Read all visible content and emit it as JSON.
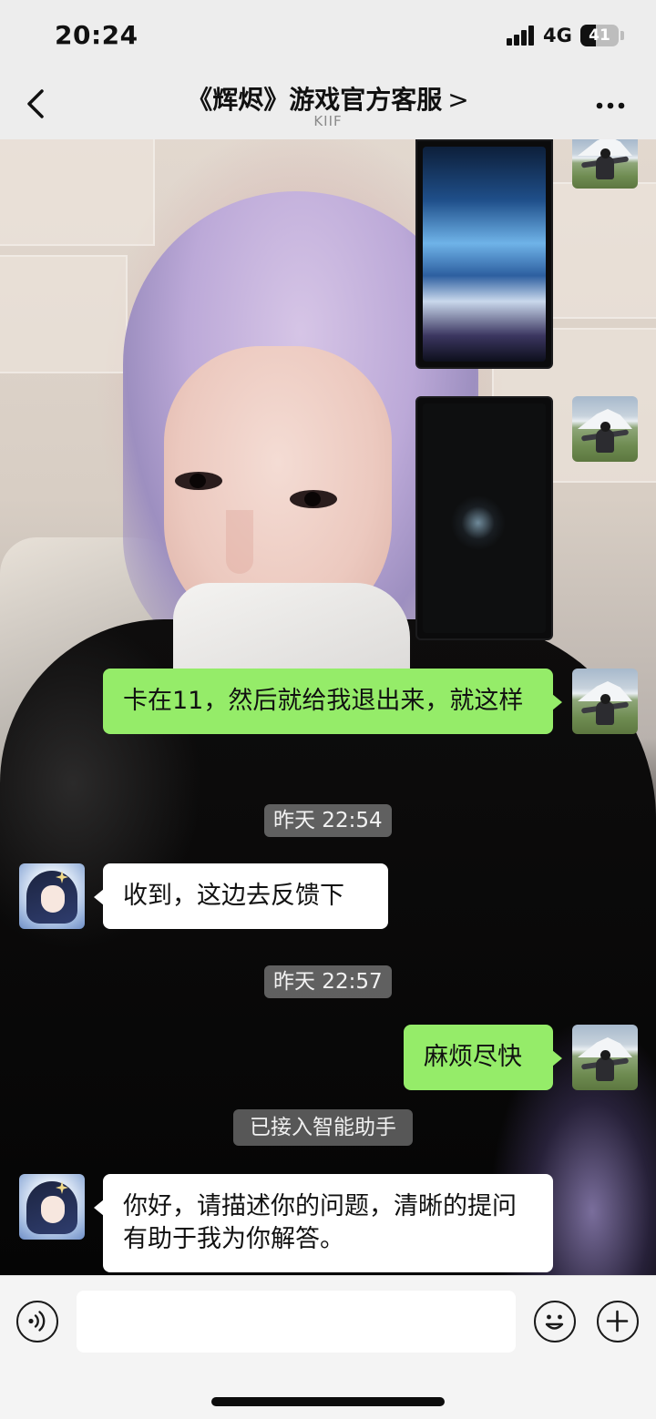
{
  "status_bar": {
    "time": "20:24",
    "network": "4G",
    "battery_level": "41",
    "battery_fraction": 0.41
  },
  "nav": {
    "title": "《辉烬》游戏官方客服",
    "title_chevron": ">",
    "subtitle": "KIIF",
    "back_icon": "chevron-left-icon",
    "more_icon": "ellipsis-icon"
  },
  "messages": [
    {
      "type": "image",
      "sender": "self",
      "description_icon": "game-screenshot"
    },
    {
      "type": "image",
      "sender": "self",
      "description_icon": "game-loading-screenshot"
    },
    {
      "type": "text",
      "sender": "self",
      "text": "卡在11，然后就给我退出来，就这样"
    },
    {
      "type": "timestamp",
      "text": "昨天 22:54"
    },
    {
      "type": "text",
      "sender": "other",
      "text": "收到，这边去反馈下"
    },
    {
      "type": "timestamp",
      "text": "昨天 22:57"
    },
    {
      "type": "text",
      "sender": "self",
      "text": "麻烦尽快"
    },
    {
      "type": "system",
      "text": "已接入智能助手"
    },
    {
      "type": "text",
      "sender": "other",
      "text": "你好，请描述你的问题，清晰的提问有助于我为你解答。"
    }
  ],
  "input_bar": {
    "voice_icon": "voice-icon",
    "emoji_icon": "emoji-icon",
    "plus_icon": "plus-icon",
    "input_value": ""
  },
  "colors": {
    "self_bubble": "#95ec69",
    "other_bubble": "#ffffff",
    "bar_bg": "#ededed"
  }
}
